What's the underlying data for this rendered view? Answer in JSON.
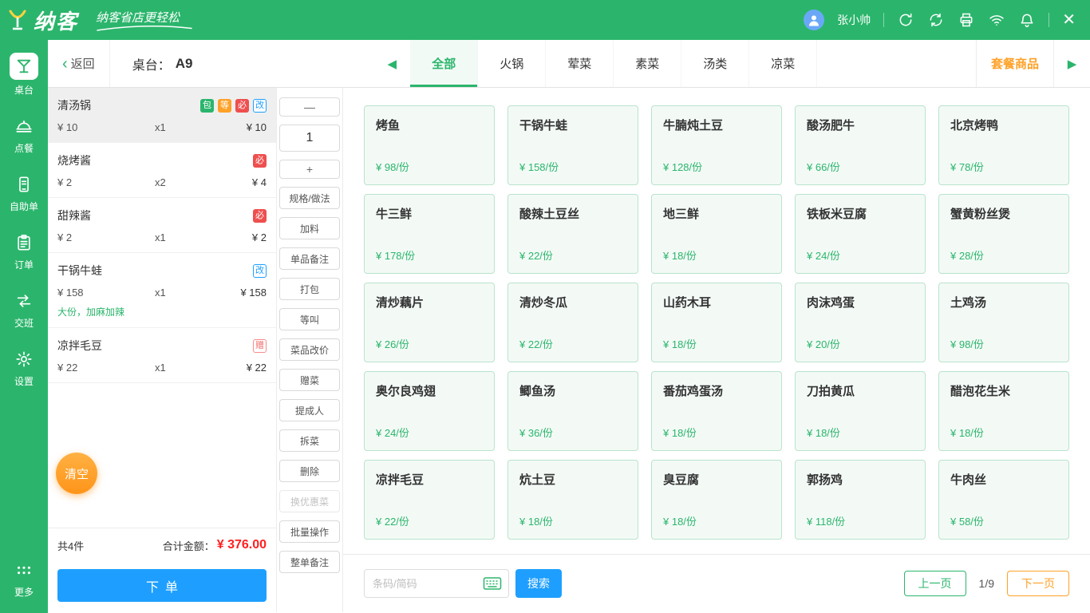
{
  "colors": {
    "brand_green": "#2bb56c",
    "accent_blue": "#1e9fff",
    "accent_orange": "#ffa128",
    "price_red": "#ff1f1f"
  },
  "header": {
    "logo": "纳客",
    "slogan": "纳客省店更轻松",
    "user": "张小帅",
    "close": "✕"
  },
  "sidebar": {
    "items": [
      {
        "label": "桌台",
        "icon": "table-icon",
        "state": "active"
      },
      {
        "label": "点餐",
        "icon": "bell-icon"
      },
      {
        "label": "自助单",
        "icon": "phone-order-icon"
      },
      {
        "label": "订单",
        "icon": "clipboard-icon"
      },
      {
        "label": "交班",
        "icon": "shift-exchange-icon"
      },
      {
        "label": "设置",
        "icon": "gear-icon"
      },
      {
        "label": "更多",
        "icon": "more-dots-icon"
      }
    ]
  },
  "topbar": {
    "back": "返回",
    "table_label": "桌台：",
    "table_no": "A9",
    "tabs": [
      {
        "label": "全部",
        "state": "active"
      },
      {
        "label": "火锅"
      },
      {
        "label": "荤菜"
      },
      {
        "label": "素菜"
      },
      {
        "label": "汤类"
      },
      {
        "label": "凉菜"
      }
    ],
    "combo": "套餐商品"
  },
  "order": {
    "items": [
      {
        "name": "清汤锅",
        "price": "¥ 10",
        "qty": "x1",
        "total": "¥ 10",
        "selected": true,
        "badges": [
          {
            "text": "包",
            "type": "packed"
          },
          {
            "text": "等",
            "type": "wait"
          },
          {
            "text": "必",
            "type": "required"
          },
          {
            "text": "改",
            "type": "modified"
          }
        ]
      },
      {
        "name": "烧烤酱",
        "price": "¥ 2",
        "qty": "x2",
        "total": "¥ 4",
        "badges": [
          {
            "text": "必",
            "type": "required"
          }
        ]
      },
      {
        "name": "甜辣酱",
        "price": "¥ 2",
        "qty": "x1",
        "total": "¥ 2",
        "badges": [
          {
            "text": "必",
            "type": "required"
          }
        ]
      },
      {
        "name": "干锅牛蛙",
        "price": "¥ 158",
        "qty": "x1",
        "total": "¥ 158",
        "note": "大份，加麻加辣",
        "badges": [
          {
            "text": "改",
            "type": "modified"
          }
        ]
      },
      {
        "name": "凉拌毛豆",
        "price": "¥ 22",
        "qty": "x1",
        "total": "¥ 22",
        "badges": [
          {
            "text": "赠",
            "type": "gift"
          }
        ]
      }
    ],
    "clear_label": "清空",
    "count_label": "共4件",
    "total_label": "合计金额：",
    "total_value": "¥ 376.00",
    "submit_label": "下单"
  },
  "toolbar": {
    "minus": "—",
    "qty": "1",
    "plus": "+",
    "buttons": [
      {
        "label": "规格/做法"
      },
      {
        "label": "加料"
      },
      {
        "label": "单品备注"
      },
      {
        "label": "打包"
      },
      {
        "label": "等叫"
      },
      {
        "label": "菜品改价"
      },
      {
        "label": "赠菜"
      },
      {
        "label": "提成人"
      },
      {
        "label": "拆菜"
      },
      {
        "label": "删除"
      },
      {
        "label": "换优惠菜",
        "state": "disabled"
      },
      {
        "label": "批量操作"
      },
      {
        "label": "整单备注"
      }
    ]
  },
  "menu": {
    "items": [
      {
        "name": "烤鱼",
        "price": "¥ 98/份"
      },
      {
        "name": "干锅牛蛙",
        "price": "¥ 158/份"
      },
      {
        "name": "牛腩炖土豆",
        "price": "¥ 128/份"
      },
      {
        "name": "酸汤肥牛",
        "price": "¥ 66/份"
      },
      {
        "name": "北京烤鸭",
        "price": "¥ 78/份"
      },
      {
        "name": "牛三鲜",
        "price": "¥ 178/份"
      },
      {
        "name": "酸辣土豆丝",
        "price": "¥ 22/份"
      },
      {
        "name": "地三鲜",
        "price": "¥ 18/份"
      },
      {
        "name": "铁板米豆腐",
        "price": "¥ 24/份"
      },
      {
        "name": "蟹黄粉丝煲",
        "price": "¥ 28/份"
      },
      {
        "name": "清炒藕片",
        "price": "¥ 26/份"
      },
      {
        "name": "清炒冬瓜",
        "price": "¥ 22/份"
      },
      {
        "name": "山药木耳",
        "price": "¥ 18/份"
      },
      {
        "name": "肉沫鸡蛋",
        "price": "¥ 20/份"
      },
      {
        "name": "土鸡汤",
        "price": "¥ 98/份"
      },
      {
        "name": "奥尔良鸡翅",
        "price": "¥ 24/份"
      },
      {
        "name": "鲫鱼汤",
        "price": "¥ 36/份"
      },
      {
        "name": "番茄鸡蛋汤",
        "price": "¥ 18/份"
      },
      {
        "name": "刀拍黄瓜",
        "price": "¥ 18/份"
      },
      {
        "name": "醋泡花生米",
        "price": "¥ 18/份"
      },
      {
        "name": "凉拌毛豆",
        "price": "¥ 22/份"
      },
      {
        "name": "炕土豆",
        "price": "¥ 18/份"
      },
      {
        "name": "臭豆腐",
        "price": "¥ 18/份"
      },
      {
        "name": "郭扬鸡",
        "price": "¥ 118/份"
      },
      {
        "name": "牛肉丝",
        "price": "¥ 58/份"
      }
    ]
  },
  "footer": {
    "search_placeholder": "条码/简码",
    "search_label": "搜索",
    "prev": "上一页",
    "page": "1/9",
    "next": "下一页"
  }
}
